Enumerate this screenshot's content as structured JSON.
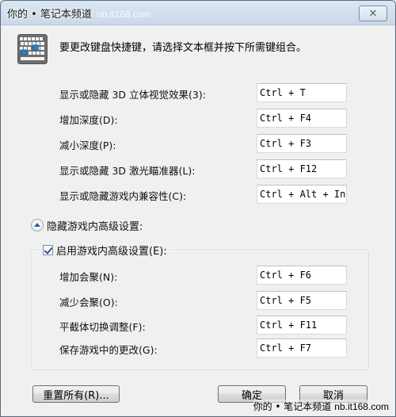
{
  "window": {
    "title": "你的 • 笔记本频道",
    "title_site": "nb.it168.com",
    "close_icon": "close-icon"
  },
  "intro": {
    "icon": "keyboard-icon",
    "text": "要更改键盘快捷键，请选择文本框并按下所需键组合。"
  },
  "shortcuts": [
    {
      "label": "显示或隐藏 3D 立体视觉效果(3):",
      "value": "Ctrl + T"
    },
    {
      "label": "增加深度(D):",
      "value": "Ctrl + F4"
    },
    {
      "label": "减小深度(P):",
      "value": "Ctrl + F3"
    },
    {
      "label": "显示或隐藏 3D 激光瞄准器(L):",
      "value": "Ctrl + F12"
    },
    {
      "label": "显示或隐藏游戏内兼容性(C):",
      "value": "Ctrl + Alt + Ins"
    }
  ],
  "advanced": {
    "toggle_label": "隐藏游戏内高级设置:",
    "toggle_icon": "collapse-up-icon",
    "enable_label": "启用游戏内高级设置(E):",
    "enable_checked": true,
    "items": [
      {
        "label": "增加会聚(N):",
        "value": "Ctrl + F6"
      },
      {
        "label": "减少会聚(O):",
        "value": "Ctrl + F5"
      },
      {
        "label": "平截体切换调整(F):",
        "value": "Ctrl + F11"
      },
      {
        "label": "保存游戏中的更改(G):",
        "value": "Ctrl + F7"
      }
    ]
  },
  "buttons": {
    "reset_all": "重置所有(R)...",
    "ok": "确定",
    "cancel": "取消"
  },
  "watermark": {
    "text": "你的 • 笔记本频道",
    "site": "nb.it168.com"
  }
}
